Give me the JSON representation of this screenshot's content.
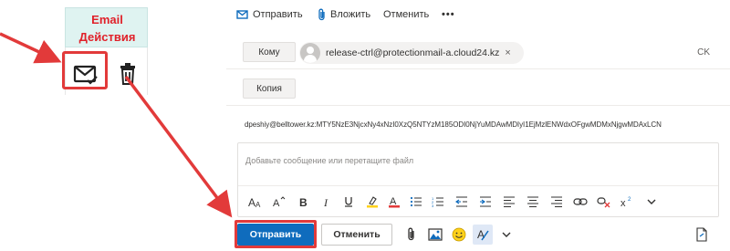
{
  "mini_table": {
    "header_line1": "Email",
    "header_line2": "Действия",
    "icons": [
      "mail-check-icon",
      "trash-icon"
    ]
  },
  "command_bar": {
    "send_label": "Отправить",
    "attach_label": "Вложить",
    "discard_label": "Отменить",
    "more_label": "•••"
  },
  "to_field": {
    "label": "Кому",
    "recipient": "release-ctrl@protectionmail-a.cloud24.kz",
    "remove_icon": "×",
    "cc_link": "CK"
  },
  "cc_field": {
    "label": "Копия"
  },
  "subject": {
    "value": "dpeshiy@belltower.kz:MTY5NzE3NjcxNy4xNzI0XzQ5NTYzM185ODI0NjYuMDAwMDIyI1EjMzlENWdxOFgwMDMxNjgwMDAxLCN"
  },
  "body": {
    "placeholder": "Добавьте сообщение или перетащите файл"
  },
  "format_toolbar": {
    "icons": [
      "font-size-icon",
      "grow-font-icon",
      "bold-icon",
      "italic-icon",
      "underline-icon",
      "highlight-icon",
      "font-color-icon",
      "bullets-icon",
      "numbering-icon",
      "decrease-indent-icon",
      "increase-indent-icon",
      "align-left-icon",
      "align-center-icon",
      "align-right-icon",
      "link-icon",
      "remove-link-icon",
      "superscript-icon",
      "more-formatting-icon"
    ]
  },
  "bottom_bar": {
    "send_label": "Отправить",
    "discard_label": "Отменить"
  },
  "colors": {
    "accent": "#0f6cbd",
    "annotation_red": "#e23a3a",
    "header_bg": "#dff3f1",
    "header_text": "#e0212a"
  }
}
